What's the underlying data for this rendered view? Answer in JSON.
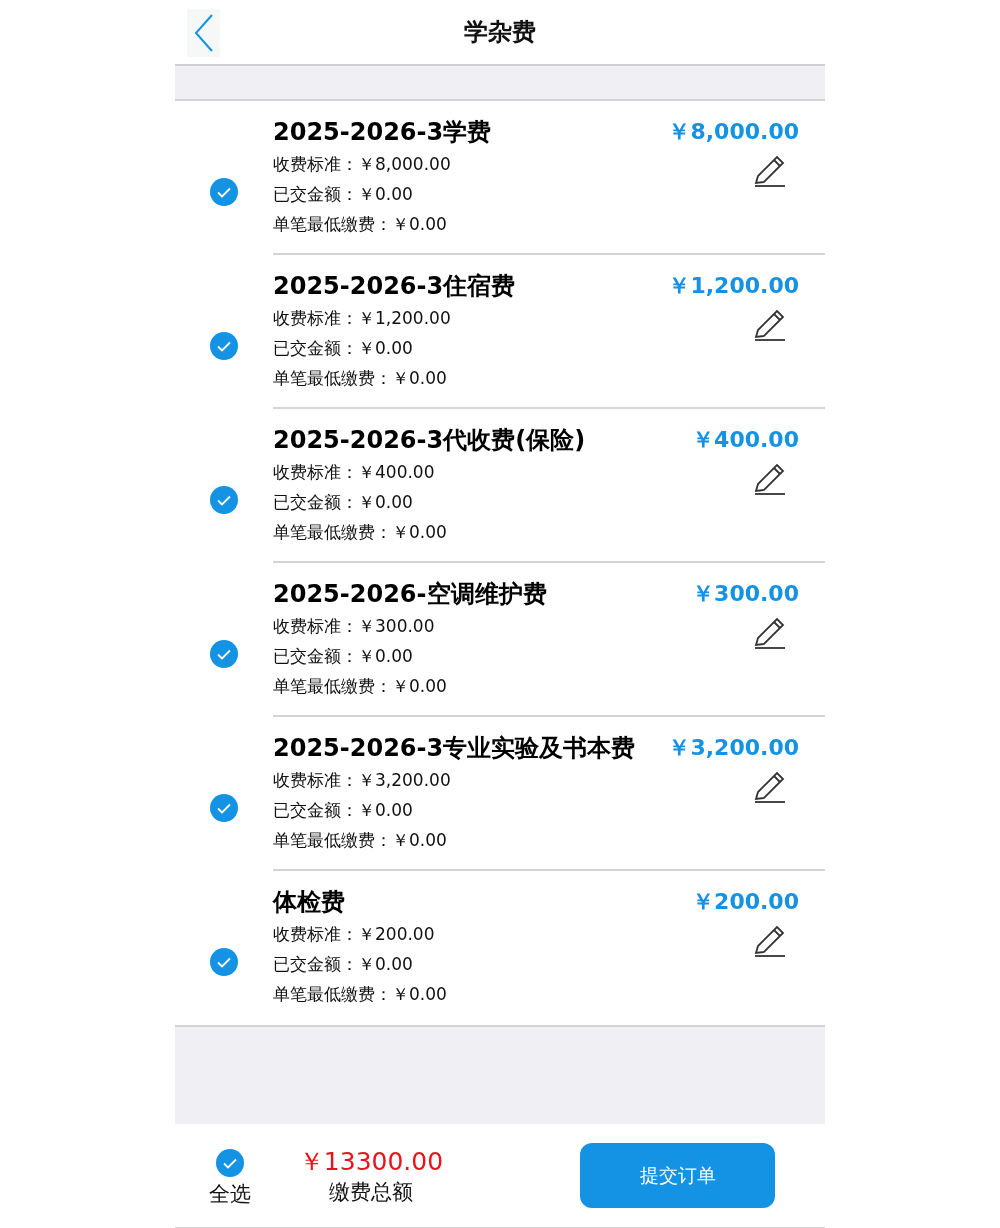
{
  "header": {
    "title": "学杂费"
  },
  "fees": [
    {
      "name": "2025-2026-3学费",
      "lines": [
        "收费标准：￥8,000.00",
        "已交金额：￥0.00",
        "单笔最低缴费：￥0.00"
      ],
      "amount": "￥8,000.00",
      "checked": true
    },
    {
      "name": "2025-2026-3住宿费",
      "lines": [
        "收费标准：￥1,200.00",
        "已交金额：￥0.00",
        "单笔最低缴费：￥0.00"
      ],
      "amount": "￥1,200.00",
      "checked": true
    },
    {
      "name": "2025-2026-3代收费(保险)",
      "lines": [
        "收费标准：￥400.00",
        "已交金额：￥0.00",
        "单笔最低缴费：￥0.00"
      ],
      "amount": "￥400.00",
      "checked": true
    },
    {
      "name": "2025-2026-空调维护费",
      "lines": [
        "收费标准：￥300.00",
        "已交金额：￥0.00",
        "单笔最低缴费：￥0.00"
      ],
      "amount": "￥300.00",
      "checked": true
    },
    {
      "name": "2025-2026-3专业实验及书本费",
      "lines": [
        "收费标准：￥3,200.00",
        "已交金额：￥0.00",
        "单笔最低缴费：￥0.00"
      ],
      "amount": "￥3,200.00",
      "checked": true
    },
    {
      "name": "体检费",
      "lines": [
        "收费标准：￥200.00",
        "已交金额：￥0.00",
        "单笔最低缴费：￥0.00"
      ],
      "amount": "￥200.00",
      "checked": true
    }
  ],
  "footer": {
    "select_all": {
      "label": "全选",
      "checked": true
    },
    "total": "￥13300.00",
    "total_label": "缴费总额",
    "submit": "提交订单"
  }
}
